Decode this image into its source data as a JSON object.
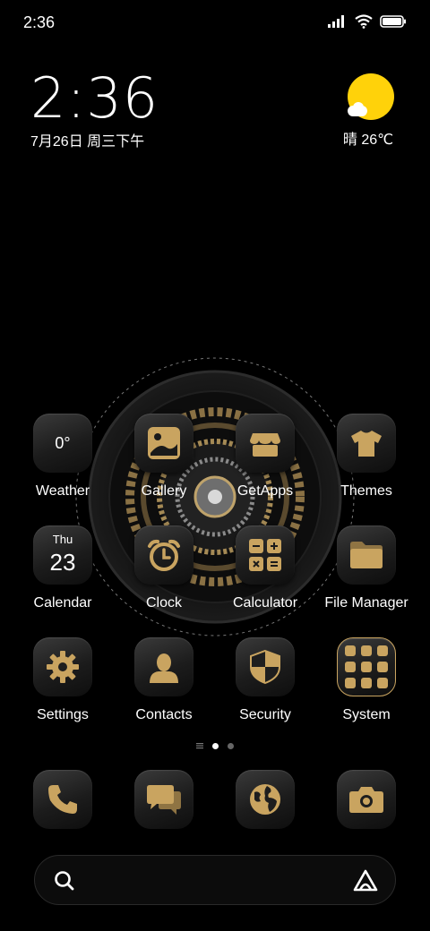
{
  "status_bar": {
    "time": "2:36"
  },
  "clock_widget": {
    "time": "2:36",
    "date": "7月26日 周三下午"
  },
  "weather_widget": {
    "condition_temp": "晴 26℃"
  },
  "apps": {
    "weather": {
      "label": "Weather",
      "value": "0°"
    },
    "gallery": {
      "label": "Gallery"
    },
    "getapps": {
      "label": "GetApps"
    },
    "themes": {
      "label": "Themes"
    },
    "calendar": {
      "label": "Calendar",
      "weekday": "Thu",
      "day": "23"
    },
    "clock": {
      "label": "Clock"
    },
    "calculator": {
      "label": "Calculator"
    },
    "file_manager": {
      "label": "File Manager"
    },
    "settings": {
      "label": "Settings"
    },
    "contacts": {
      "label": "Contacts"
    },
    "security": {
      "label": "Security"
    },
    "system": {
      "label": "System"
    }
  },
  "dock": [
    "phone-icon",
    "messages-icon",
    "browser-icon",
    "camera-icon"
  ],
  "page_indicator": {
    "pages": 2,
    "current": 1
  },
  "colors": {
    "gold": "#c9a460",
    "sun": "#ffd20a",
    "background": "#000000"
  }
}
